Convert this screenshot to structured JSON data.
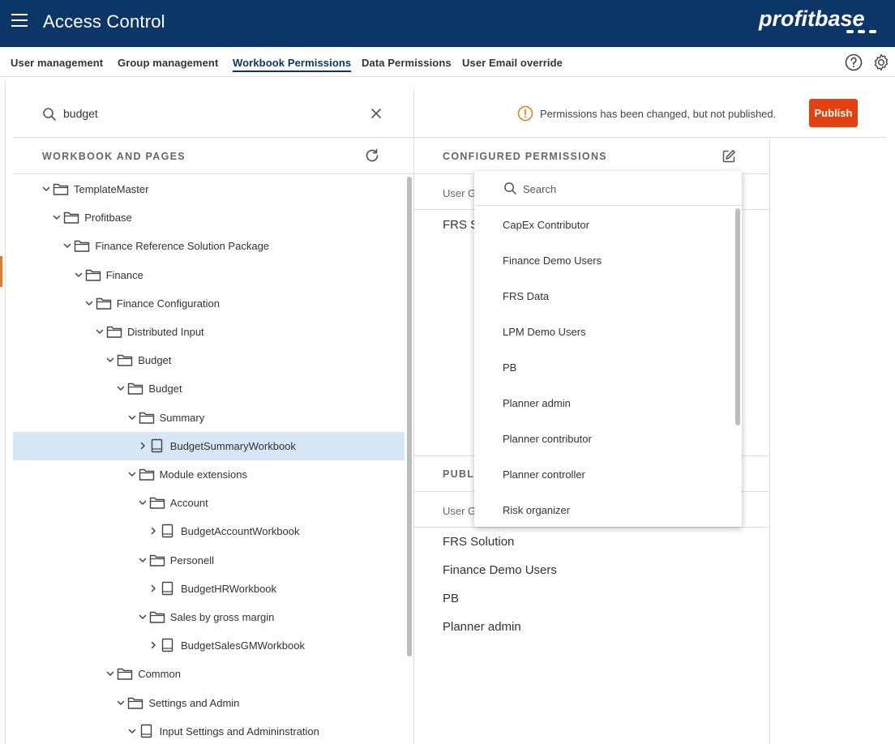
{
  "app": {
    "title": "Access Control",
    "logo_text": "profitbase"
  },
  "nav": {
    "tabs": [
      {
        "label": "User management",
        "active": false
      },
      {
        "label": "Group management",
        "active": false
      },
      {
        "label": "Workbook Permissions",
        "active": true
      },
      {
        "label": "Data Permissions",
        "active": false
      },
      {
        "label": "User Email override",
        "active": false
      }
    ],
    "icons": [
      "help-icon",
      "settings-icon"
    ]
  },
  "left": {
    "search_value": "budget",
    "section_title": "WORKBOOK AND PAGES",
    "tree": [
      {
        "label": "TemplateMaster",
        "type": "folder",
        "level": 0,
        "expanded": true
      },
      {
        "label": "Profitbase",
        "type": "folder",
        "level": 1,
        "expanded": true
      },
      {
        "label": "Finance Reference Solution Package",
        "type": "folder",
        "level": 2,
        "expanded": true
      },
      {
        "label": "Finance",
        "type": "folder",
        "level": 3,
        "expanded": true
      },
      {
        "label": "Finance Configuration",
        "type": "folder",
        "level": 4,
        "expanded": true
      },
      {
        "label": "Distributed Input",
        "type": "folder",
        "level": 5,
        "expanded": true
      },
      {
        "label": "Budget",
        "type": "folder",
        "level": 6,
        "expanded": true
      },
      {
        "label": "Budget",
        "type": "folder",
        "level": 7,
        "expanded": true
      },
      {
        "label": "Summary",
        "type": "folder",
        "level": 8,
        "expanded": true
      },
      {
        "label": "BudgetSummaryWorkbook",
        "type": "workbook",
        "level": 9,
        "expanded": false,
        "selected": true
      },
      {
        "label": "Module extensions",
        "type": "folder",
        "level": 8,
        "expanded": true
      },
      {
        "label": "Account",
        "type": "folder",
        "level": 9,
        "expanded": true
      },
      {
        "label": "BudgetAccountWorkbook",
        "type": "workbook",
        "level": 10,
        "expanded": false
      },
      {
        "label": "Personell",
        "type": "folder",
        "level": 9,
        "expanded": true
      },
      {
        "label": "BudgetHRWorkbook",
        "type": "workbook",
        "level": 10,
        "expanded": false
      },
      {
        "label": "Sales by gross margin",
        "type": "folder",
        "level": 9,
        "expanded": true
      },
      {
        "label": "BudgetSalesGMWorkbook",
        "type": "workbook",
        "level": 10,
        "expanded": false
      },
      {
        "label": "Common",
        "type": "folder",
        "level": 6,
        "expanded": true
      },
      {
        "label": "Settings and Admin",
        "type": "folder",
        "level": 7,
        "expanded": true
      },
      {
        "label": "Input Settings and Admininstration",
        "type": "workbook",
        "level": 8,
        "expanded": true
      }
    ]
  },
  "right": {
    "warning_text": "Permissions has been changed, but not published.",
    "publish_label": "Publish",
    "configured_title": "CONFIGURED PERMISSIONS",
    "configured_col_header": "User G",
    "configured_first_item": "FRS S",
    "published_title": "PUBLI",
    "published_col_header": "User G",
    "published_items": [
      "FRS Solution",
      "Finance Demo Users",
      "PB",
      "Planner admin"
    ]
  },
  "dropdown": {
    "search_placeholder": "Search",
    "items": [
      "CapEx Contributor",
      "Finance Demo Users",
      "FRS Data",
      "LPM Demo Users",
      "PB",
      "Planner admin",
      "Planner contributor",
      "Planner controller",
      "Risk organizer"
    ]
  },
  "colors": {
    "header_bg": "#0c3668",
    "publish_bg": "#e3410f",
    "warning": "#f0801a",
    "selected_row": "#d6e7f5"
  }
}
